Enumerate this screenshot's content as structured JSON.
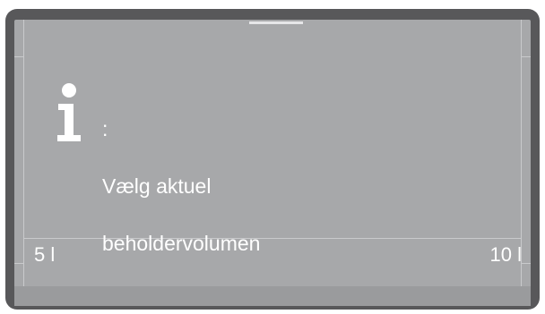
{
  "dialog": {
    "icon": "info-icon",
    "title_suffix": ":",
    "message_line1": "Vælg aktuel",
    "message_line2": "beholdervolumen"
  },
  "scale": {
    "min_label": "5 l",
    "max_label": "10 l"
  },
  "colors": {
    "bezel": "#58585a",
    "screen": "#a7a8aa",
    "text": "#ffffff"
  }
}
